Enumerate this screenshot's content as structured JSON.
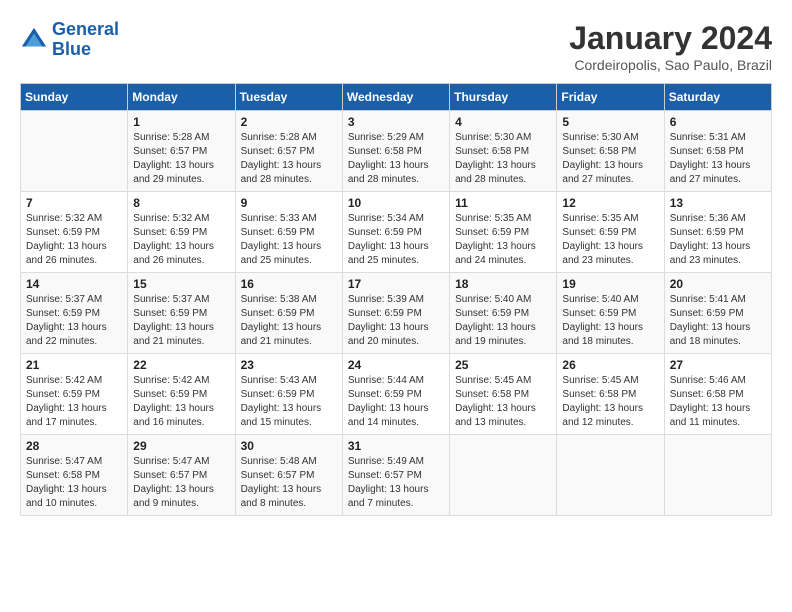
{
  "logo": {
    "text1": "General",
    "text2": "Blue"
  },
  "title": "January 2024",
  "subtitle": "Cordeiropolis, Sao Paulo, Brazil",
  "days_of_week": [
    "Sunday",
    "Monday",
    "Tuesday",
    "Wednesday",
    "Thursday",
    "Friday",
    "Saturday"
  ],
  "weeks": [
    [
      {
        "day": "",
        "sunrise": "",
        "sunset": "",
        "daylight": ""
      },
      {
        "day": "1",
        "sunrise": "Sunrise: 5:28 AM",
        "sunset": "Sunset: 6:57 PM",
        "daylight": "Daylight: 13 hours and 29 minutes."
      },
      {
        "day": "2",
        "sunrise": "Sunrise: 5:28 AM",
        "sunset": "Sunset: 6:57 PM",
        "daylight": "Daylight: 13 hours and 28 minutes."
      },
      {
        "day": "3",
        "sunrise": "Sunrise: 5:29 AM",
        "sunset": "Sunset: 6:58 PM",
        "daylight": "Daylight: 13 hours and 28 minutes."
      },
      {
        "day": "4",
        "sunrise": "Sunrise: 5:30 AM",
        "sunset": "Sunset: 6:58 PM",
        "daylight": "Daylight: 13 hours and 28 minutes."
      },
      {
        "day": "5",
        "sunrise": "Sunrise: 5:30 AM",
        "sunset": "Sunset: 6:58 PM",
        "daylight": "Daylight: 13 hours and 27 minutes."
      },
      {
        "day": "6",
        "sunrise": "Sunrise: 5:31 AM",
        "sunset": "Sunset: 6:58 PM",
        "daylight": "Daylight: 13 hours and 27 minutes."
      }
    ],
    [
      {
        "day": "7",
        "sunrise": "Sunrise: 5:32 AM",
        "sunset": "Sunset: 6:59 PM",
        "daylight": "Daylight: 13 hours and 26 minutes."
      },
      {
        "day": "8",
        "sunrise": "Sunrise: 5:32 AM",
        "sunset": "Sunset: 6:59 PM",
        "daylight": "Daylight: 13 hours and 26 minutes."
      },
      {
        "day": "9",
        "sunrise": "Sunrise: 5:33 AM",
        "sunset": "Sunset: 6:59 PM",
        "daylight": "Daylight: 13 hours and 25 minutes."
      },
      {
        "day": "10",
        "sunrise": "Sunrise: 5:34 AM",
        "sunset": "Sunset: 6:59 PM",
        "daylight": "Daylight: 13 hours and 25 minutes."
      },
      {
        "day": "11",
        "sunrise": "Sunrise: 5:35 AM",
        "sunset": "Sunset: 6:59 PM",
        "daylight": "Daylight: 13 hours and 24 minutes."
      },
      {
        "day": "12",
        "sunrise": "Sunrise: 5:35 AM",
        "sunset": "Sunset: 6:59 PM",
        "daylight": "Daylight: 13 hours and 23 minutes."
      },
      {
        "day": "13",
        "sunrise": "Sunrise: 5:36 AM",
        "sunset": "Sunset: 6:59 PM",
        "daylight": "Daylight: 13 hours and 23 minutes."
      }
    ],
    [
      {
        "day": "14",
        "sunrise": "Sunrise: 5:37 AM",
        "sunset": "Sunset: 6:59 PM",
        "daylight": "Daylight: 13 hours and 22 minutes."
      },
      {
        "day": "15",
        "sunrise": "Sunrise: 5:37 AM",
        "sunset": "Sunset: 6:59 PM",
        "daylight": "Daylight: 13 hours and 21 minutes."
      },
      {
        "day": "16",
        "sunrise": "Sunrise: 5:38 AM",
        "sunset": "Sunset: 6:59 PM",
        "daylight": "Daylight: 13 hours and 21 minutes."
      },
      {
        "day": "17",
        "sunrise": "Sunrise: 5:39 AM",
        "sunset": "Sunset: 6:59 PM",
        "daylight": "Daylight: 13 hours and 20 minutes."
      },
      {
        "day": "18",
        "sunrise": "Sunrise: 5:40 AM",
        "sunset": "Sunset: 6:59 PM",
        "daylight": "Daylight: 13 hours and 19 minutes."
      },
      {
        "day": "19",
        "sunrise": "Sunrise: 5:40 AM",
        "sunset": "Sunset: 6:59 PM",
        "daylight": "Daylight: 13 hours and 18 minutes."
      },
      {
        "day": "20",
        "sunrise": "Sunrise: 5:41 AM",
        "sunset": "Sunset: 6:59 PM",
        "daylight": "Daylight: 13 hours and 18 minutes."
      }
    ],
    [
      {
        "day": "21",
        "sunrise": "Sunrise: 5:42 AM",
        "sunset": "Sunset: 6:59 PM",
        "daylight": "Daylight: 13 hours and 17 minutes."
      },
      {
        "day": "22",
        "sunrise": "Sunrise: 5:42 AM",
        "sunset": "Sunset: 6:59 PM",
        "daylight": "Daylight: 13 hours and 16 minutes."
      },
      {
        "day": "23",
        "sunrise": "Sunrise: 5:43 AM",
        "sunset": "Sunset: 6:59 PM",
        "daylight": "Daylight: 13 hours and 15 minutes."
      },
      {
        "day": "24",
        "sunrise": "Sunrise: 5:44 AM",
        "sunset": "Sunset: 6:59 PM",
        "daylight": "Daylight: 13 hours and 14 minutes."
      },
      {
        "day": "25",
        "sunrise": "Sunrise: 5:45 AM",
        "sunset": "Sunset: 6:58 PM",
        "daylight": "Daylight: 13 hours and 13 minutes."
      },
      {
        "day": "26",
        "sunrise": "Sunrise: 5:45 AM",
        "sunset": "Sunset: 6:58 PM",
        "daylight": "Daylight: 13 hours and 12 minutes."
      },
      {
        "day": "27",
        "sunrise": "Sunrise: 5:46 AM",
        "sunset": "Sunset: 6:58 PM",
        "daylight": "Daylight: 13 hours and 11 minutes."
      }
    ],
    [
      {
        "day": "28",
        "sunrise": "Sunrise: 5:47 AM",
        "sunset": "Sunset: 6:58 PM",
        "daylight": "Daylight: 13 hours and 10 minutes."
      },
      {
        "day": "29",
        "sunrise": "Sunrise: 5:47 AM",
        "sunset": "Sunset: 6:57 PM",
        "daylight": "Daylight: 13 hours and 9 minutes."
      },
      {
        "day": "30",
        "sunrise": "Sunrise: 5:48 AM",
        "sunset": "Sunset: 6:57 PM",
        "daylight": "Daylight: 13 hours and 8 minutes."
      },
      {
        "day": "31",
        "sunrise": "Sunrise: 5:49 AM",
        "sunset": "Sunset: 6:57 PM",
        "daylight": "Daylight: 13 hours and 7 minutes."
      },
      {
        "day": "",
        "sunrise": "",
        "sunset": "",
        "daylight": ""
      },
      {
        "day": "",
        "sunrise": "",
        "sunset": "",
        "daylight": ""
      },
      {
        "day": "",
        "sunrise": "",
        "sunset": "",
        "daylight": ""
      }
    ]
  ]
}
